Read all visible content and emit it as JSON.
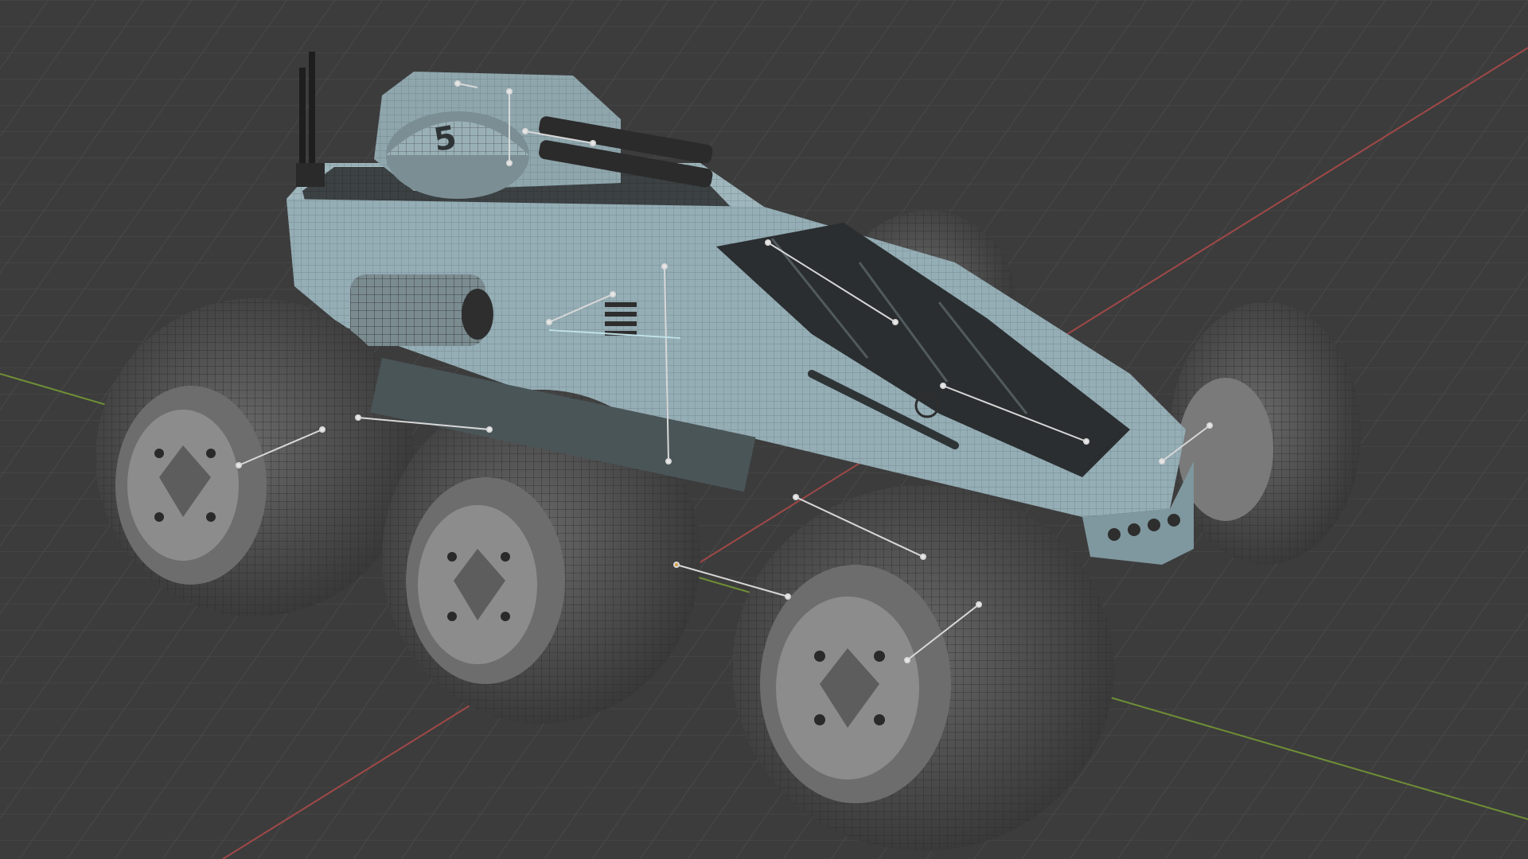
{
  "app": {
    "viewport_background": "#3c3c3c",
    "grid_color": "#4a4a4a",
    "x_axis_color": "#a84a4a",
    "y_axis_color": "#7a9a3a"
  },
  "model": {
    "hull_color": "#9fb6bd",
    "tire_color": "#4d4d4d",
    "rim_color": "#8c8c8c",
    "glass_color": "#2a2e30",
    "turret_decal": "5"
  },
  "icons": [
    "wireframe-mesh-icon",
    "gizmo-helper-lines-icon"
  ]
}
